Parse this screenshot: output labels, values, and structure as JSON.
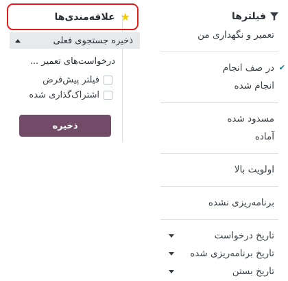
{
  "filters": {
    "title": "فیلترها",
    "icon": "funnel-icon",
    "groups": [
      [
        "تعمیر و نگهداری من"
      ],
      [
        "در صف انجام",
        "انجام شده"
      ],
      [
        "مسدود شده",
        "آماده"
      ],
      [
        "اولویت بالا"
      ],
      [
        "برنامه‌ریزی نشده"
      ]
    ],
    "date_filters": [
      "تاریخ درخواست",
      "تاریخ برنامه‌ریزی شده",
      "تاریخ بستن"
    ],
    "checked": "در صف انجام"
  },
  "favorites": {
    "title": "علاقه‌مندی‌ها",
    "icon": "star-icon",
    "save_current_search": "ذخیره جستجوی فعلی",
    "search_name": "درخواست‌های تعمیر ...",
    "default_filter_label": "فیلتر پیش‌فرض",
    "shared_label": "اشتراک‌گذاری شده",
    "save_button": "ذخیره"
  },
  "colors": {
    "accent": "#714b67",
    "highlight_border": "#e21b1b",
    "star": "#f3cc00",
    "check": "#117a8b"
  }
}
